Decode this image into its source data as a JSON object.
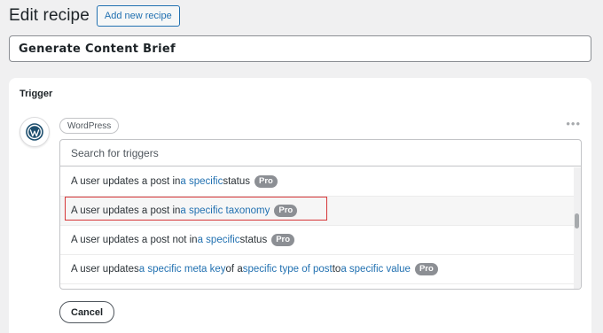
{
  "header": {
    "title": "Edit recipe",
    "add_new_label": "Add new recipe"
  },
  "recipe": {
    "title_value": "Generate Content Brief"
  },
  "trigger": {
    "heading": "Trigger",
    "integration": "WordPress",
    "icon": "wordpress-icon",
    "search_placeholder": "Search for triggers",
    "options": [
      {
        "parts": [
          "A user updates a post in ",
          "a specific",
          " status"
        ],
        "pro": "Pro"
      },
      {
        "parts": [
          "A user updates a post in ",
          "a specific taxonomy",
          ""
        ],
        "pro": "Pro"
      },
      {
        "parts": [
          "A user updates a post not in ",
          "a specific",
          " status"
        ],
        "pro": "Pro"
      },
      {
        "parts": [
          "A user updates ",
          "a specific meta key",
          " of a ",
          "specific type of post",
          " to ",
          "a specific value",
          ""
        ],
        "pro": "Pro"
      }
    ],
    "cancel_label": "Cancel"
  },
  "colors": {
    "accent": "#2271b1",
    "highlight": "#d63638",
    "pro_badge": "#8c8f94"
  }
}
